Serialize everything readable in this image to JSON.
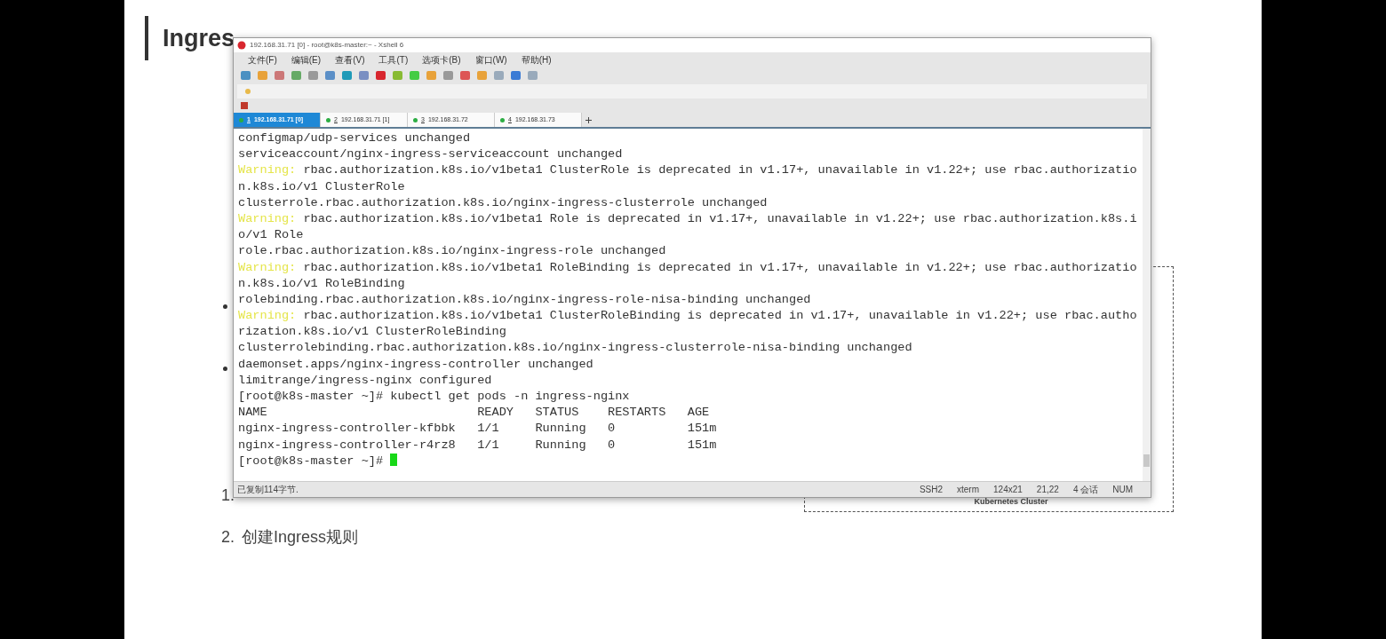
{
  "slide": {
    "title": "Ingres",
    "steps": [
      {
        "number": "1."
      },
      {
        "number": "2.",
        "text": "创建Ingress规则"
      }
    ],
    "diagram": {
      "label": "Kubernetes Cluster"
    }
  },
  "window": {
    "title": "192.168.31.71 [0] - root@k8s-master:~ - Xshell 6",
    "menu": [
      "文件(F)",
      "编辑(E)",
      "查看(V)",
      "工具(T)",
      "选项卡(B)",
      "窗口(W)",
      "帮助(H)"
    ],
    "tabs": [
      {
        "number": "1",
        "label": "192.168.31.71 [0]",
        "selected": true
      },
      {
        "number": "2",
        "label": "192.168.31.71 [1]",
        "selected": false
      },
      {
        "number": "3",
        "label": "192.168.31.72",
        "selected": false
      },
      {
        "number": "4",
        "label": "192.168.31.73",
        "selected": false
      }
    ],
    "terminal": [
      {
        "kind": "plain",
        "text": "configmap/udp-services unchanged"
      },
      {
        "kind": "plain",
        "text": "serviceaccount/nginx-ingress-serviceaccount unchanged"
      },
      {
        "kind": "warning",
        "prefix": "Warning:",
        "text": " rbac.authorization.k8s.io/v1beta1 ClusterRole is deprecated in v1.17+, unavailable in v1.22+; use rbac.authorizatio"
      },
      {
        "kind": "plain",
        "text": "n.k8s.io/v1 ClusterRole"
      },
      {
        "kind": "plain",
        "text": "clusterrole.rbac.authorization.k8s.io/nginx-ingress-clusterrole unchanged"
      },
      {
        "kind": "warning",
        "prefix": "Warning:",
        "text": " rbac.authorization.k8s.io/v1beta1 Role is deprecated in v1.17+, unavailable in v1.22+; use rbac.authorization.k8s.i"
      },
      {
        "kind": "plain",
        "text": "o/v1 Role"
      },
      {
        "kind": "plain",
        "text": "role.rbac.authorization.k8s.io/nginx-ingress-role unchanged"
      },
      {
        "kind": "warning",
        "prefix": "Warning:",
        "text": " rbac.authorization.k8s.io/v1beta1 RoleBinding is deprecated in v1.17+, unavailable in v1.22+; use rbac.authorizatio"
      },
      {
        "kind": "plain",
        "text": "n.k8s.io/v1 RoleBinding"
      },
      {
        "kind": "plain",
        "text": "rolebinding.rbac.authorization.k8s.io/nginx-ingress-role-nisa-binding unchanged"
      },
      {
        "kind": "warning",
        "prefix": "Warning:",
        "text": " rbac.authorization.k8s.io/v1beta1 ClusterRoleBinding is deprecated in v1.17+, unavailable in v1.22+; use rbac.autho"
      },
      {
        "kind": "plain",
        "text": "rization.k8s.io/v1 ClusterRoleBinding"
      },
      {
        "kind": "plain",
        "text": "clusterrolebinding.rbac.authorization.k8s.io/nginx-ingress-clusterrole-nisa-binding unchanged"
      },
      {
        "kind": "plain",
        "text": "daemonset.apps/nginx-ingress-controller unchanged"
      },
      {
        "kind": "plain",
        "text": "limitrange/ingress-nginx configured"
      },
      {
        "kind": "plain",
        "text": "[root@k8s-master ~]# kubectl get pods -n ingress-nginx"
      },
      {
        "kind": "plain",
        "text": "NAME                             READY   STATUS    RESTARTS   AGE"
      },
      {
        "kind": "plain",
        "text": "nginx-ingress-controller-kfbbk   1/1     Running   0          151m"
      },
      {
        "kind": "plain",
        "text": "nginx-ingress-controller-r4rz8   1/1     Running   0          151m"
      },
      {
        "kind": "prompt",
        "text": "[root@k8s-master ~]# ",
        "cursor": true
      }
    ],
    "status_bar": {
      "message": "已复制114字节.",
      "items": [
        "SSH2",
        "xterm",
        "124x21",
        "21,22",
        "4 会话",
        "NUM"
      ]
    }
  }
}
